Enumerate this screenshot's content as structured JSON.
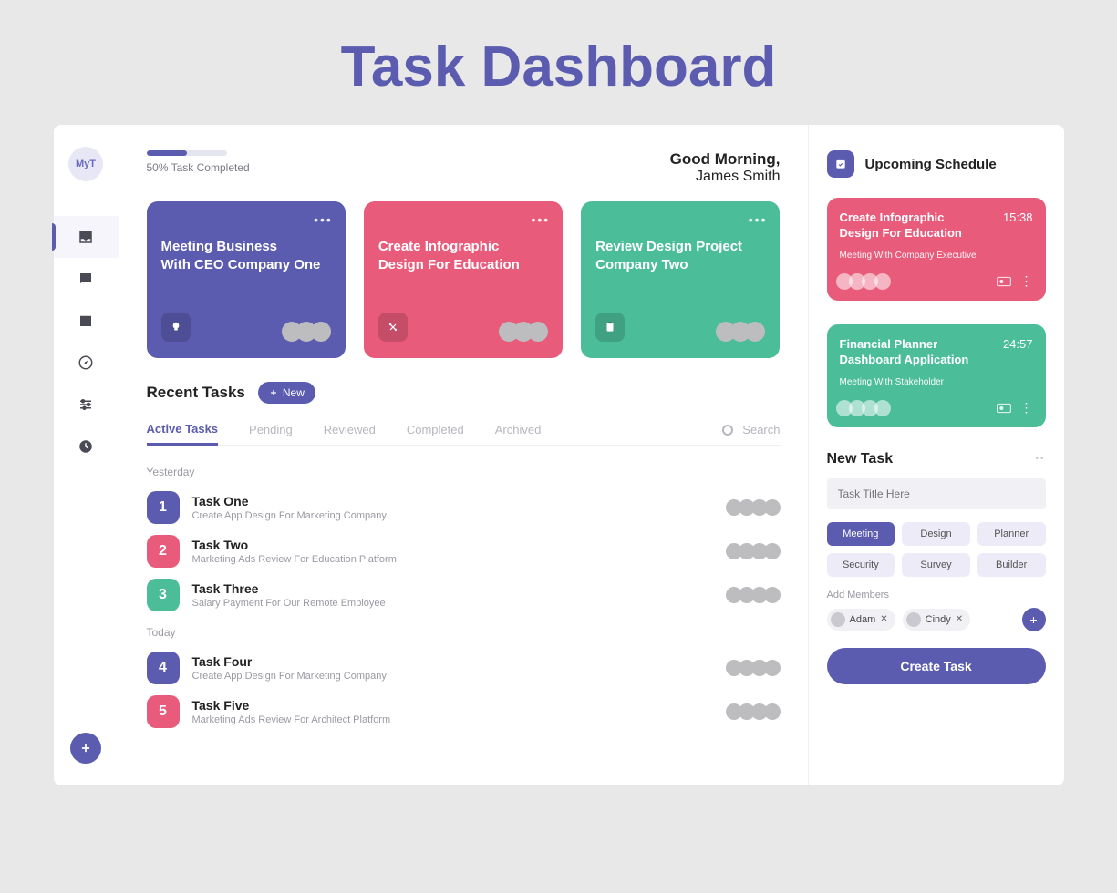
{
  "page_title": "Task Dashboard",
  "sidebar": {
    "logo": "MyT"
  },
  "header": {
    "progress_text": "50% Task Completed",
    "progress_percent": 50,
    "greeting": "Good Morning,",
    "user_name": "James Smith"
  },
  "cards": [
    {
      "title": "Meeting Business\nWith CEO Company One",
      "color": "purple"
    },
    {
      "title": "Create Infographic\nDesign For Education",
      "color": "pink"
    },
    {
      "title": "Review Design Project\nCompany Two",
      "color": "green"
    }
  ],
  "recent": {
    "title": "Recent Tasks",
    "new_btn": "New",
    "tabs": [
      "Active Tasks",
      "Pending",
      "Reviewed",
      "Completed",
      "Archived"
    ],
    "search": "Search",
    "groups": [
      {
        "label": "Yesterday",
        "tasks": [
          {
            "num": "1",
            "color": "purple",
            "name": "Task One",
            "desc": "Create App Design For Marketing Company"
          },
          {
            "num": "2",
            "color": "pink",
            "name": "Task Two",
            "desc": "Marketing Ads Review For Education Platform"
          },
          {
            "num": "3",
            "color": "green",
            "name": "Task Three",
            "desc": "Salary Payment For Our Remote Employee"
          }
        ]
      },
      {
        "label": "Today",
        "tasks": [
          {
            "num": "4",
            "color": "purple",
            "name": "Task Four",
            "desc": "Create App Design For Marketing Company"
          },
          {
            "num": "5",
            "color": "pink",
            "name": "Task Five",
            "desc": "Marketing Ads Review For Architect Platform"
          }
        ]
      }
    ]
  },
  "schedule": {
    "title": "Upcoming Schedule",
    "items": [
      {
        "title": "Create Infographic Design For Education",
        "time": "15:38",
        "sub": "Meeting With Company Executive",
        "color": "pink"
      },
      {
        "title": "Financial Planner Dashboard Application",
        "time": "24:57",
        "sub": "Meeting With Stakeholder",
        "color": "green"
      }
    ]
  },
  "newtask": {
    "title": "New Task",
    "placeholder": "Task Title Here",
    "tags_row1": [
      "Meeting",
      "Design",
      "Planner"
    ],
    "tags_row2": [
      "Security",
      "Survey",
      "Builder"
    ],
    "add_members_label": "Add Members",
    "members": [
      "Adam",
      "Cindy"
    ],
    "create_btn": "Create Task"
  }
}
